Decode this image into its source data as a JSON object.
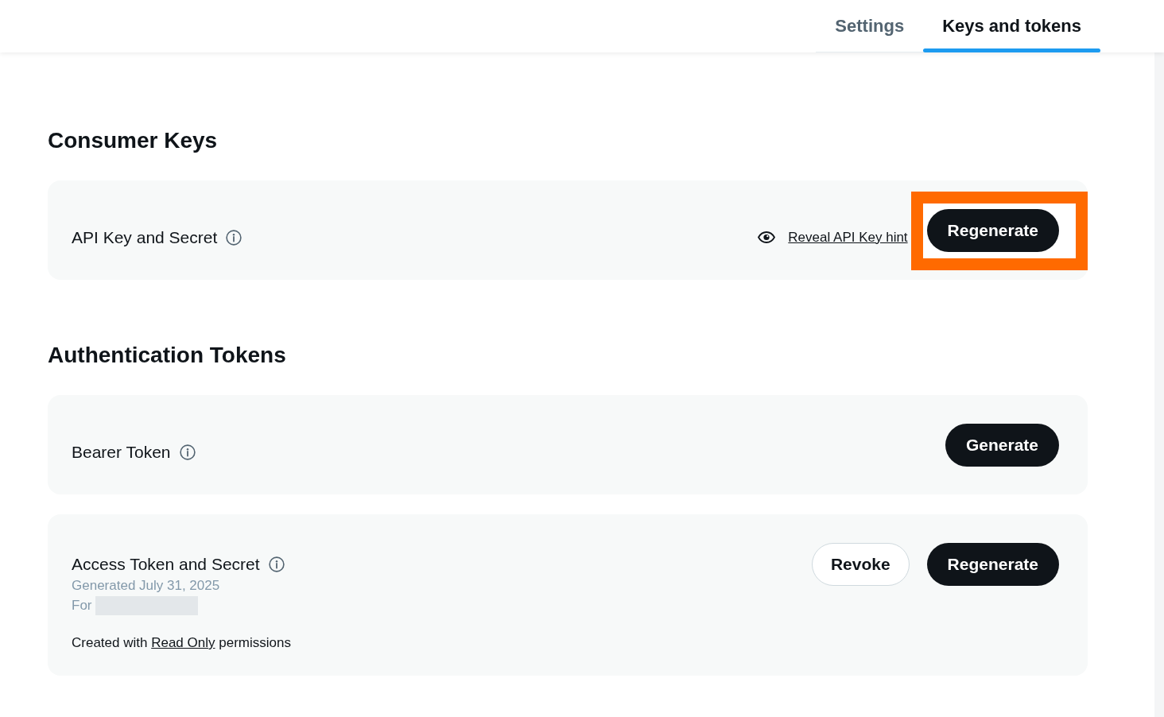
{
  "tabs": [
    {
      "label": "Settings",
      "selected": false
    },
    {
      "label": "Keys and tokens",
      "selected": true
    }
  ],
  "sections": [
    {
      "title": "Consumer Keys",
      "cards": [
        {
          "title": "API Key and Secret",
          "reveal_link": "Reveal API Key hint",
          "buttons": [
            {
              "label": "Regenerate",
              "kind": "primary",
              "highlighted": true
            }
          ]
        }
      ]
    },
    {
      "title": "Authentication Tokens",
      "cards": [
        {
          "title": "Bearer Token",
          "buttons": [
            {
              "label": "Generate",
              "kind": "primary",
              "highlighted": false
            }
          ]
        },
        {
          "title": "Access Token and Secret",
          "generated": "Generated July 31, 2025",
          "owner": {
            "label": "For",
            "redacted": true
          },
          "permissions": {
            "prefix": "Created with",
            "link": "Read Only",
            "suffix": "permissions"
          },
          "buttons": [
            {
              "label": "Revoke",
              "kind": "outline",
              "highlighted": false
            },
            {
              "label": "Regenerate",
              "kind": "primary",
              "highlighted": false
            }
          ]
        }
      ]
    }
  ]
}
